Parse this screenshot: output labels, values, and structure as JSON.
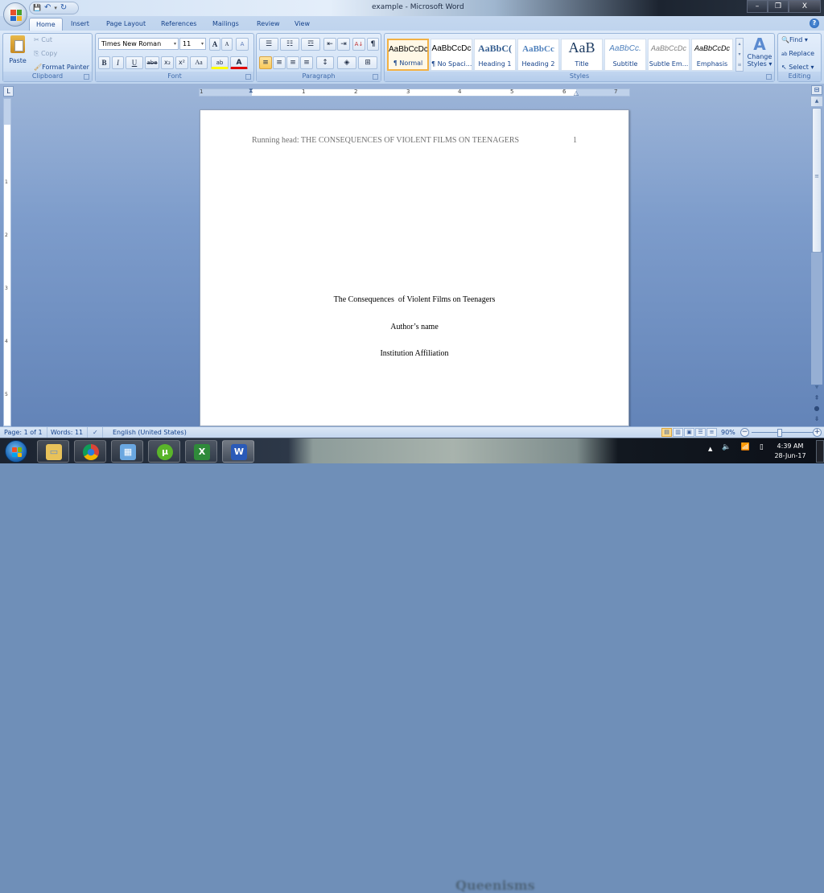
{
  "window": {
    "title": "example - Microsoft Word",
    "controls": {
      "minimize": "–",
      "restore": "❐",
      "close": "X"
    }
  },
  "quick_access": {
    "save": "💾",
    "undo": "↶",
    "undo_drop": "▾",
    "redo": "↻",
    "customize": "▾"
  },
  "tabs": [
    "Home",
    "Insert",
    "Page Layout",
    "References",
    "Mailings",
    "Review",
    "View"
  ],
  "active_tab": "Home",
  "help_icon": "?",
  "ribbon": {
    "clipboard": {
      "label": "Clipboard",
      "paste": "Paste",
      "cut": "Cut",
      "copy": "Copy",
      "format_painter": "Format Painter"
    },
    "font": {
      "label": "Font",
      "font_name": "Times New Roman",
      "font_size": "11",
      "grow": "A",
      "shrink": "A",
      "clear": "A",
      "bold": "B",
      "italic": "I",
      "underline": "U",
      "strike": "abe",
      "subscript": "x₂",
      "superscript": "x²",
      "change_case": "Aa",
      "highlight": "ab",
      "font_color": "A",
      "highlight_color": "#ffff00",
      "font_color_value": "#e00000"
    },
    "paragraph": {
      "label": "Paragraph",
      "bullets": "☰",
      "numbering": "☷",
      "multilevel": "☲",
      "decrease_indent": "⇤",
      "increase_indent": "⇥",
      "sort": "A↓",
      "show_marks": "¶",
      "align_left": "≡",
      "center": "≡",
      "align_right": "≡",
      "justify": "≡",
      "line_spacing": "↕",
      "shading": "◈",
      "borders": "⊞"
    },
    "styles": {
      "label": "Styles",
      "items": [
        {
          "preview": "AaBbCcDc",
          "name": "¶ Normal",
          "selected": true
        },
        {
          "preview": "AaBbCcDc",
          "name": "¶ No Spaci..."
        },
        {
          "preview": "AaBbC(",
          "name": "Heading 1"
        },
        {
          "preview": "AaBbCc",
          "name": "Heading 2"
        },
        {
          "preview": "AaB",
          "name": "Title"
        },
        {
          "preview": "AaBbCc.",
          "name": "Subtitle"
        },
        {
          "preview": "AaBbCcDc",
          "name": "Subtle Em..."
        },
        {
          "preview": "AaBbCcDc",
          "name": "Emphasis"
        }
      ],
      "change_styles": "Change Styles ▾",
      "change_styles_icon": "A"
    },
    "editing": {
      "label": "Editing",
      "find": "Find ▾",
      "replace": "Replace",
      "select": "Select ▾"
    }
  },
  "rulers": {
    "corner": "L",
    "h_numbers": [
      "1",
      "1",
      "2",
      "3",
      "4",
      "5",
      "6",
      "7"
    ],
    "v_numbers": [
      "1",
      "2",
      "3",
      "4",
      "5"
    ]
  },
  "document": {
    "running_head": "Running head: THE CONSEQUENCES OF VIOLENT FILMS ON TEENAGERS",
    "page_number": "1",
    "title": "The Consequences  of Violent Films on Teenagers",
    "author": "Author’s name",
    "affiliation": "Institution Affiliation"
  },
  "status_bar": {
    "page": "Page: 1 of 1",
    "words": "Words: 11",
    "proofing_icon": "✓",
    "language": "English (United States)",
    "zoom_level": "90%",
    "zoom_percent": 90
  },
  "taskbar": {
    "apps": [
      {
        "name": "file-explorer",
        "glyph": "▭",
        "color": "#e8c25a"
      },
      {
        "name": "chrome",
        "glyph": "●",
        "color": "#2a7be0"
      },
      {
        "name": "calculator",
        "glyph": "▦",
        "color": "#6aa7e0"
      },
      {
        "name": "utorrent",
        "glyph": "µ",
        "color": "#5ab52a"
      },
      {
        "name": "excel",
        "glyph": "X",
        "color": "#2f8a3a"
      },
      {
        "name": "word",
        "glyph": "W",
        "color": "#2a5ab8"
      }
    ],
    "tray": {
      "arrow": "▲",
      "volume": "🔈",
      "signal": "📶",
      "battery": "▯"
    },
    "time": "4:39 AM",
    "date": "28-Jun-17",
    "background_text": "Queenisms"
  }
}
